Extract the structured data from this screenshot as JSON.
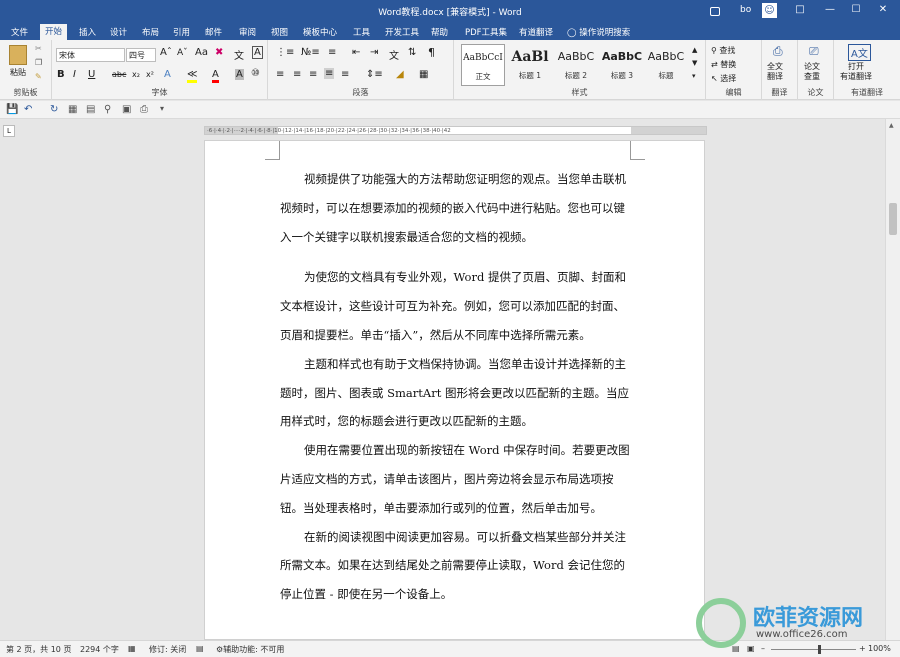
{
  "window": {
    "title": "Word教程.docx [兼容模式] - Word",
    "user": "bo",
    "controls": [
      "minimize",
      "maximize",
      "close"
    ]
  },
  "tabs": [
    "文件",
    "开始",
    "插入",
    "设计",
    "布局",
    "引用",
    "邮件",
    "审阅",
    "视图",
    "模板中心",
    "工具",
    "开发工具",
    "帮助",
    "PDF工具集",
    "有道翻译",
    "操作说明搜索"
  ],
  "active_tab": "开始",
  "ribbon": {
    "clipboard": {
      "paste": "粘贴",
      "label": "剪贴板"
    },
    "font": {
      "name": "宋体",
      "size": "四号",
      "label": "字体",
      "color_accent": "#ff0000",
      "highlight": "#ffff00"
    },
    "paragraph": {
      "label": "段落"
    },
    "styles": {
      "label": "样式",
      "items": [
        {
          "sample": "AaBbCcI",
          "name": "正文"
        },
        {
          "sample": "AaBl",
          "name": "标题 1"
        },
        {
          "sample": "AaBbC",
          "name": "标题 2"
        },
        {
          "sample": "AaBbC",
          "name": "标题 3"
        },
        {
          "sample": "AaBbC",
          "name": "标题"
        }
      ]
    },
    "editing": {
      "find": "查找",
      "replace": "替换",
      "select": "选择",
      "label": "编辑"
    },
    "translate": {
      "full": "全文\n翻译",
      "label": "翻译"
    },
    "paper": {
      "check": "论文\n查重",
      "label": "论文"
    },
    "youdao": {
      "open": "打开\n有道翻译",
      "label": "有道翻译"
    }
  },
  "document": {
    "paragraphs": [
      "视频提供了功能强大的方法帮助您证明您的观点。当您单击联机视频时，可以在想要添加的视频的嵌入代码中进行粘贴。您也可以键入一个关键字以联机搜索最适合您的文档的视频。",
      "为使您的文档具有专业外观，Word 提供了页眉、页脚、封面和文本框设计，这些设计可互为补充。例如，您可以添加匹配的封面、页眉和提要栏。单击“插入”，然后从不同库中选择所需元素。",
      "主题和样式也有助于文档保持协调。当您单击设计并选择新的主题时，图片、图表或 SmartArt 图形将会更改以匹配新的主题。当应用样式时，您的标题会进行更改以匹配新的主题。",
      "使用在需要位置出现的新按钮在 Word 中保存时间。若要更改图片适应文档的方式，请单击该图片，图片旁边将会显示布局选项按钮。当处理表格时，单击要添加行或列的位置，然后单击加号。",
      "在新的阅读视图中阅读更加容易。可以折叠文档某些部分并关注所需文本。如果在达到结尾处之前需要停止读取，Word 会记住您的停止位置 - 即使在另一个设备上。"
    ]
  },
  "status": {
    "page": "第 2 页，共 10 页",
    "words": "2294 个字",
    "revisions": "修订: 关闭",
    "accessibility": "辅助功能: 不可用",
    "zoom": "100%",
    "zoom_level": 0.55
  },
  "watermark": {
    "text": "欧菲资源网",
    "url": "www.office26.com"
  },
  "colors": {
    "brand": "#2b579a"
  }
}
